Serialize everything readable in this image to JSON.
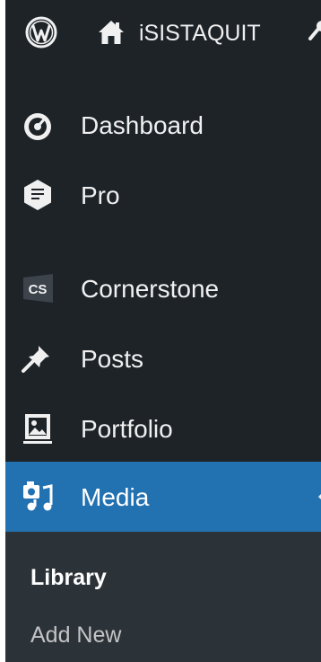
{
  "admin_bar": {
    "site_name": "iSISTAQUIT",
    "icons": [
      "wordpress-logo-icon",
      "home-icon",
      "customize-icon"
    ]
  },
  "menu": {
    "items": [
      {
        "label": "Dashboard",
        "icon": "dashboard-icon"
      },
      {
        "label": "Pro",
        "icon": "pro-icon"
      },
      {
        "label": "Cornerstone",
        "icon": "cornerstone-icon",
        "icon_text": "CS"
      },
      {
        "label": "Posts",
        "icon": "posts-icon"
      },
      {
        "label": "Portfolio",
        "icon": "portfolio-icon"
      },
      {
        "label": "Media",
        "icon": "media-icon",
        "current": true
      }
    ],
    "media_submenu": [
      {
        "label": "Library",
        "current": true
      },
      {
        "label": "Add New",
        "current": false
      }
    ]
  },
  "colors": {
    "menu_background": "#1d2327",
    "submenu_background": "#2c3338",
    "current_highlight": "#2271b1",
    "menu_text": "#f0f0f1",
    "submenu_text": "#c3c4c7"
  }
}
